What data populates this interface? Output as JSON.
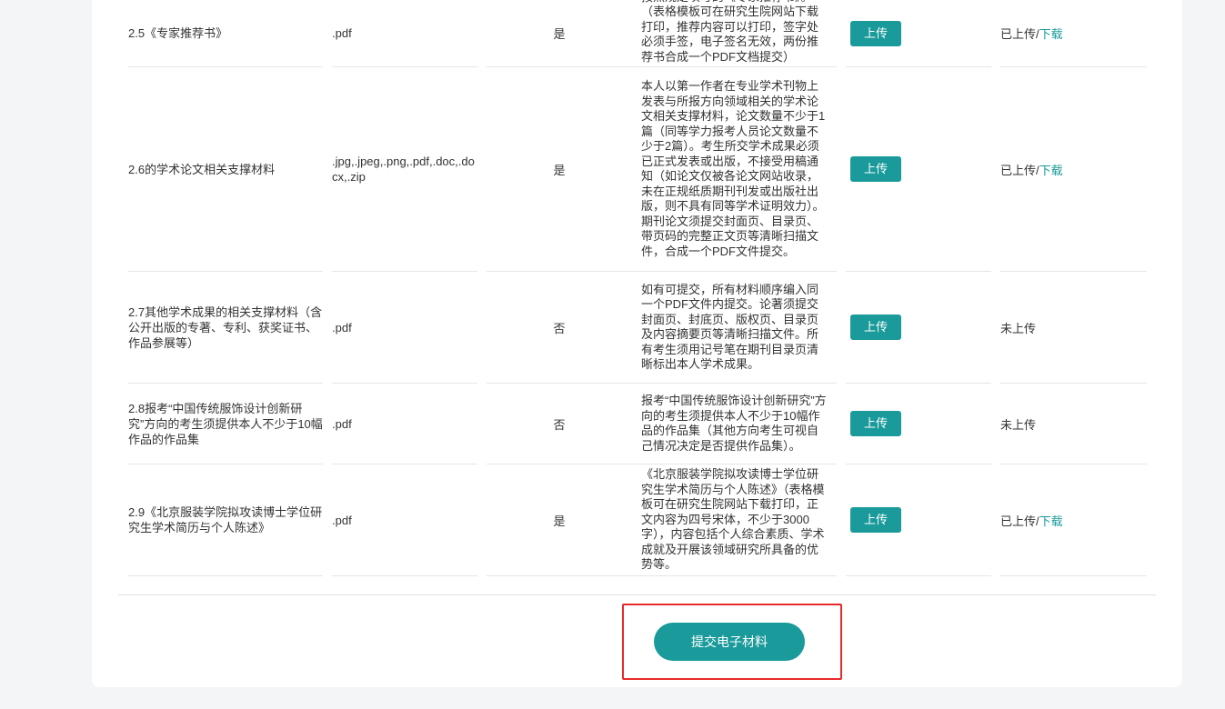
{
  "rows": [
    {
      "name": "2.5《专家推荐书》",
      "format": ".pdf",
      "required": "是",
      "description": "按照规定填写的《专家推荐书》。（表格模板可在研究生院网站下载打印，推荐内容可以打印，签字处必须手签，电子签名无效，两份推荐书合成一个PDF文档提交）",
      "upload_label": "上传",
      "status": "已上传/",
      "download_label": "下载"
    },
    {
      "name": "2.6的学术论文相关支撑材料",
      "format": ".jpg,.jpeg,.png,.pdf,.doc,.docx,.zip",
      "required": "是",
      "description": "本人以第一作者在专业学术刊物上发表与所报方向领域相关的学术论文相关支撑材料，论文数量不少于1篇（同等学力报考人员论文数量不少于2篇）。考生所交学术成果必须已正式发表或出版，不接受用稿通知（如论文仅被各论文网站收录，未在正规纸质期刊刊发或出版社出版，则不具有同等学术证明效力）。期刊论文须提交封面页、目录页、带页码的完整正文页等清晰扫描文件，合成一个PDF文件提交。",
      "upload_label": "上传",
      "status": "已上传/",
      "download_label": "下载"
    },
    {
      "name": "2.7其他学术成果的相关支撑材料（含公开出版的专著、专利、获奖证书、作品参展等）",
      "format": ".pdf",
      "required": "否",
      "description": "如有可提交，所有材料顺序编入同一个PDF文件内提交。论著须提交封面页、封底页、版权页、目录页及内容摘要页等清晰扫描文件。所有考生须用记号笔在期刊目录页清晰标出本人学术成果。",
      "upload_label": "上传",
      "status": "未上传",
      "download_label": ""
    },
    {
      "name": "2.8报考“中国传统服饰设计创新研究”方向的考生须提供本人不少于10幅作品的作品集",
      "format": ".pdf",
      "required": "否",
      "description": "报考“中国传统服饰设计创新研究”方向的考生须提供本人不少于10幅作品的作品集（其他方向考生可视自己情况决定是否提供作品集）。",
      "upload_label": "上传",
      "status": "未上传",
      "download_label": ""
    },
    {
      "name": "2.9《北京服装学院拟攻读博士学位研究生学术简历与个人陈述》",
      "format": ".pdf",
      "required": "是",
      "description": "《北京服装学院拟攻读博士学位研究生学术简历与个人陈述》（表格模板可在研究生院网站下载打印，正文内容为四号宋体，不少于3000字），内容包括个人综合素质、学术成就及开展该领域研究所具备的优势等。",
      "upload_label": "上传",
      "status": "已上传/",
      "download_label": "下载"
    }
  ],
  "submit": {
    "label": "提交电子材料"
  },
  "colors": {
    "accent": "#1a9a9a",
    "highlight": "#e82929"
  }
}
